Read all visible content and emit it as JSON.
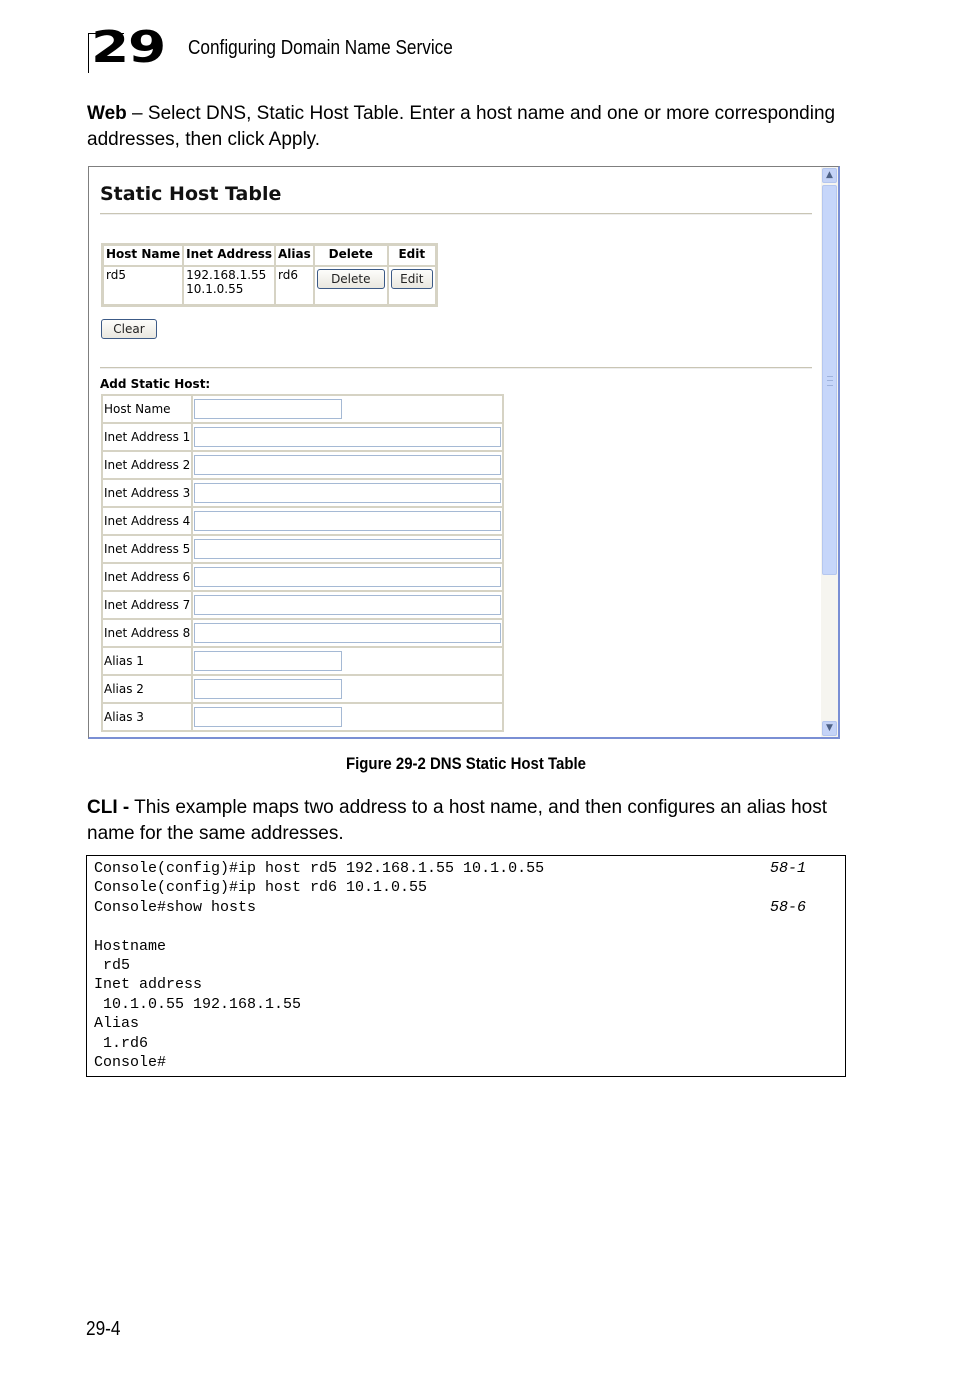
{
  "header": {
    "chapter_number": "29",
    "chapter_title": "Configuring Domain Name Service"
  },
  "intro": {
    "lead": "Web",
    "text": " – Select DNS, Static Host Table. Enter a host name and one or more corresponding addresses, then click Apply."
  },
  "screenshot": {
    "heading": "Static Host Table",
    "host_table": {
      "columns": [
        "Host Name",
        "Inet Address",
        "Alias",
        "Delete",
        "Edit"
      ],
      "rows": [
        {
          "host_name": "rd5",
          "inet_address_1": "192.168.1.55",
          "inet_address_2": "10.1.0.55",
          "alias": "rd6",
          "delete_label": "Delete",
          "edit_label": "Edit"
        }
      ]
    },
    "clear_label": "Clear",
    "add_section_title": "Add Static Host:",
    "add_fields": [
      {
        "label": "Host Name",
        "value": ""
      },
      {
        "label": "Inet Address 1",
        "value": ""
      },
      {
        "label": "Inet Address 2",
        "value": ""
      },
      {
        "label": "Inet Address 3",
        "value": ""
      },
      {
        "label": "Inet Address 4",
        "value": ""
      },
      {
        "label": "Inet Address 5",
        "value": ""
      },
      {
        "label": "Inet Address 6",
        "value": ""
      },
      {
        "label": "Inet Address 7",
        "value": ""
      },
      {
        "label": "Inet Address 8",
        "value": ""
      },
      {
        "label": "Alias 1",
        "value": ""
      },
      {
        "label": "Alias 2",
        "value": ""
      },
      {
        "label": "Alias 3",
        "value": ""
      }
    ],
    "scroll_up_icon": "▲",
    "scroll_down_icon": "▼"
  },
  "caption": "Figure 29-2  DNS Static Host Table",
  "cli_intro": {
    "lead": "CLI -",
    "text": " This example maps two address to a host name, and then configures an alias host name for the same addresses."
  },
  "code": {
    "lines": [
      {
        "text": "Console(config)#ip host rd5 192.168.1.55 10.1.0.55",
        "ref": "58-1"
      },
      {
        "text": "Console(config)#ip host rd6 10.1.0.55",
        "ref": ""
      },
      {
        "text": "Console#show hosts",
        "ref": "58-6"
      },
      {
        "text": "",
        "ref": ""
      },
      {
        "text": "Hostname",
        "ref": ""
      },
      {
        "text": " rd5",
        "ref": ""
      },
      {
        "text": "Inet address",
        "ref": ""
      },
      {
        "text": " 10.1.0.55 192.168.1.55",
        "ref": ""
      },
      {
        "text": "Alias",
        "ref": ""
      },
      {
        "text": " 1.rd6",
        "ref": ""
      },
      {
        "text": "Console#",
        "ref": ""
      }
    ]
  },
  "footer": {
    "page_number": "29-4"
  }
}
